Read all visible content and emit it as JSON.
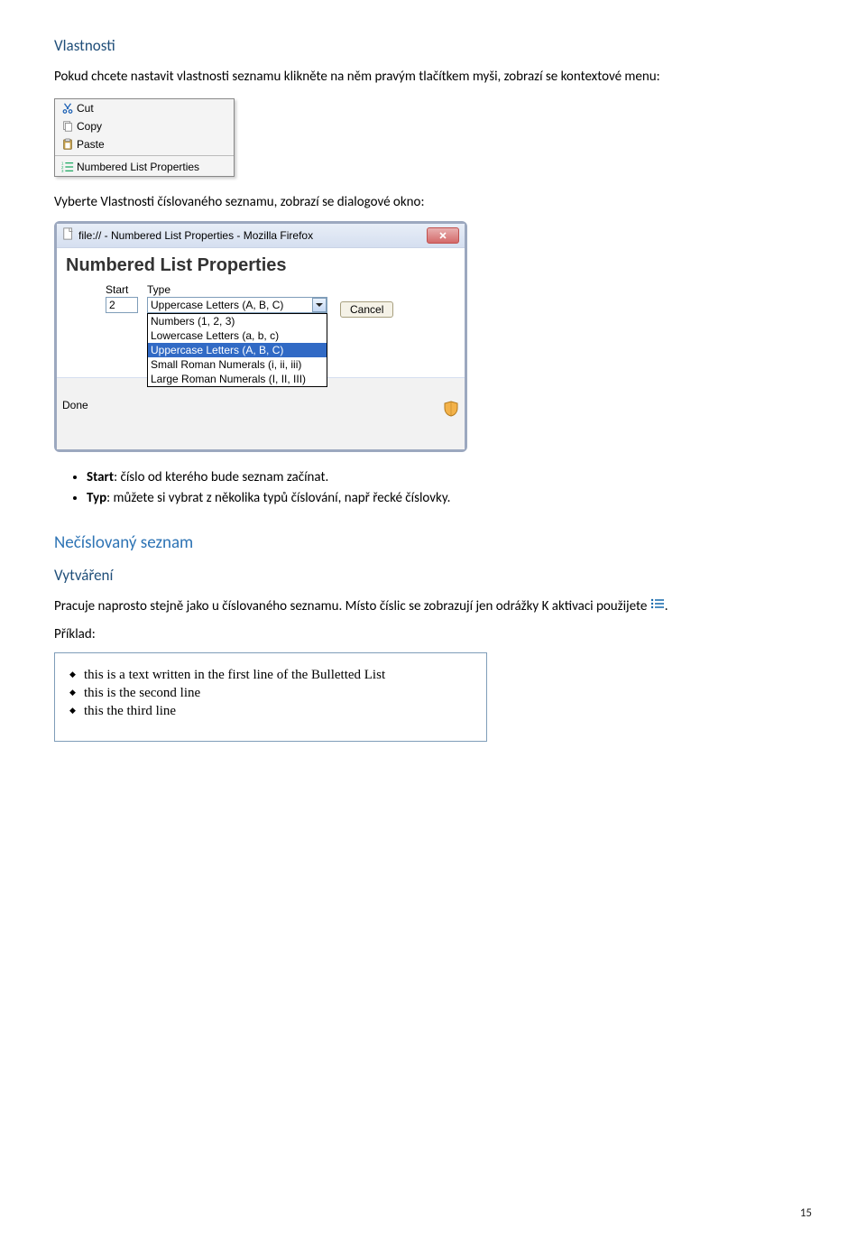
{
  "sections": {
    "vlastnosti_title": "Vlastnosti",
    "vlastnosti_intro": "Pokud chcete nastavit vlastnosti seznamu klikněte na něm pravým tlačítkem myši, zobrazí se kontextové menu:",
    "select_props": "Vyberte Vlastnosti číslovaného seznamu, zobrazí se dialogové okno:",
    "bullet_start_label": "Start",
    "bullet_start_text": ": číslo od kterého bude seznam začínat.",
    "bullet_typ_label": "Typ",
    "bullet_typ_text": ": můžete si vybrat z několika typů číslování, např řecké číslovky.",
    "necislovany_title": "Nečíslovaný seznam",
    "vytvareni_title": "Vytváření",
    "necislovany_text_a": "Pracuje naprosto stejně jako u číslovaného seznamu. Místo číslic se zobrazují jen odrážky K aktivaci použijete ",
    "necislovany_text_b": ".",
    "priklad_label": "Příklad:"
  },
  "context_menu": {
    "cut": "Cut",
    "copy": "Copy",
    "paste": "Paste",
    "numbered_props": "Numbered List Properties"
  },
  "dialog": {
    "title": "file:// - Numbered List Properties - Mozilla Firefox",
    "heading": "Numbered List Properties",
    "start_label": "Start",
    "start_value": "2",
    "type_label": "Type",
    "type_value": "Uppercase Letters (A, B, C)",
    "type_options": [
      "Numbers (1, 2, 3)",
      "Lowercase Letters (a, b, c)",
      "Uppercase Letters (A, B, C)",
      "Small Roman Numerals (i, ii, iii)",
      "Large Roman Numerals (I, II, III)"
    ],
    "cancel": "Cancel",
    "done": "Done"
  },
  "example_list": {
    "items": [
      "this is a text written in the first line of the Bulletted List",
      "this is the second line",
      "this the third line"
    ]
  },
  "page_number": "15"
}
